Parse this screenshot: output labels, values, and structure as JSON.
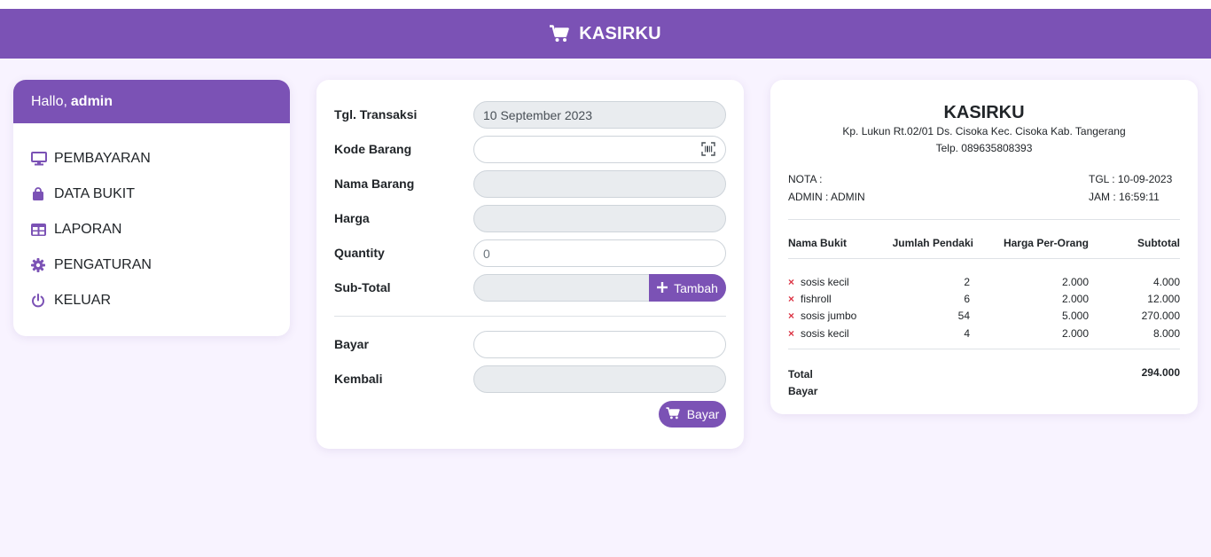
{
  "app": {
    "title": "KASIRKU"
  },
  "sidebar": {
    "greeting": "Hallo,",
    "username": "admin",
    "items": [
      {
        "label": "PEMBAYARAN",
        "icon": "monitor-icon"
      },
      {
        "label": "DATA BUKIT",
        "icon": "shopping-bag-icon"
      },
      {
        "label": "LAPORAN",
        "icon": "table-icon"
      },
      {
        "label": "PENGATURAN",
        "icon": "gear-icon"
      },
      {
        "label": "KELUAR",
        "icon": "power-icon"
      }
    ]
  },
  "form": {
    "tgl_label": "Tgl. Transaksi",
    "tgl_value": "10 September 2023",
    "kode_label": "Kode Barang",
    "kode_value": "",
    "nama_label": "Nama Barang",
    "nama_value": "",
    "harga_label": "Harga",
    "harga_value": "",
    "qty_label": "Quantity",
    "qty_placeholder": "0",
    "subtotal_label": "Sub-Total",
    "subtotal_value": "",
    "tambah_label": "Tambah",
    "bayar_label": "Bayar",
    "bayar_value": "",
    "kembali_label": "Kembali",
    "kembali_value": "",
    "bayar_button": "Bayar"
  },
  "receipt": {
    "title": "KASIRKU",
    "address": "Kp. Lukun Rt.02/01 Ds. Cisoka Kec. Cisoka Kab. Tangerang",
    "phone": "Telp. 089635808393",
    "nota": "NOTA :",
    "admin": "ADMIN : ADMIN",
    "tgl": "TGL : 10-09-2023",
    "jam": "JAM : 16:59:11",
    "headers": [
      "Nama Bukit",
      "Jumlah Pendaki",
      "Harga Per-Orang",
      "Subtotal"
    ],
    "rows": [
      {
        "name": "sosis kecil",
        "qty": "2",
        "price": "2.000",
        "subtotal": "4.000"
      },
      {
        "name": "fishroll",
        "qty": "6",
        "price": "2.000",
        "subtotal": "12.000"
      },
      {
        "name": "sosis jumbo",
        "qty": "54",
        "price": "5.000",
        "subtotal": "270.000"
      },
      {
        "name": "sosis kecil",
        "qty": "4",
        "price": "2.000",
        "subtotal": "8.000"
      }
    ],
    "remove_symbol": "×",
    "total_label": "Total Bayar",
    "total_value": "294.000"
  },
  "colors": {
    "brand": "#7b52b5",
    "background": "#f8f3ff",
    "danger": "#dc3545"
  }
}
